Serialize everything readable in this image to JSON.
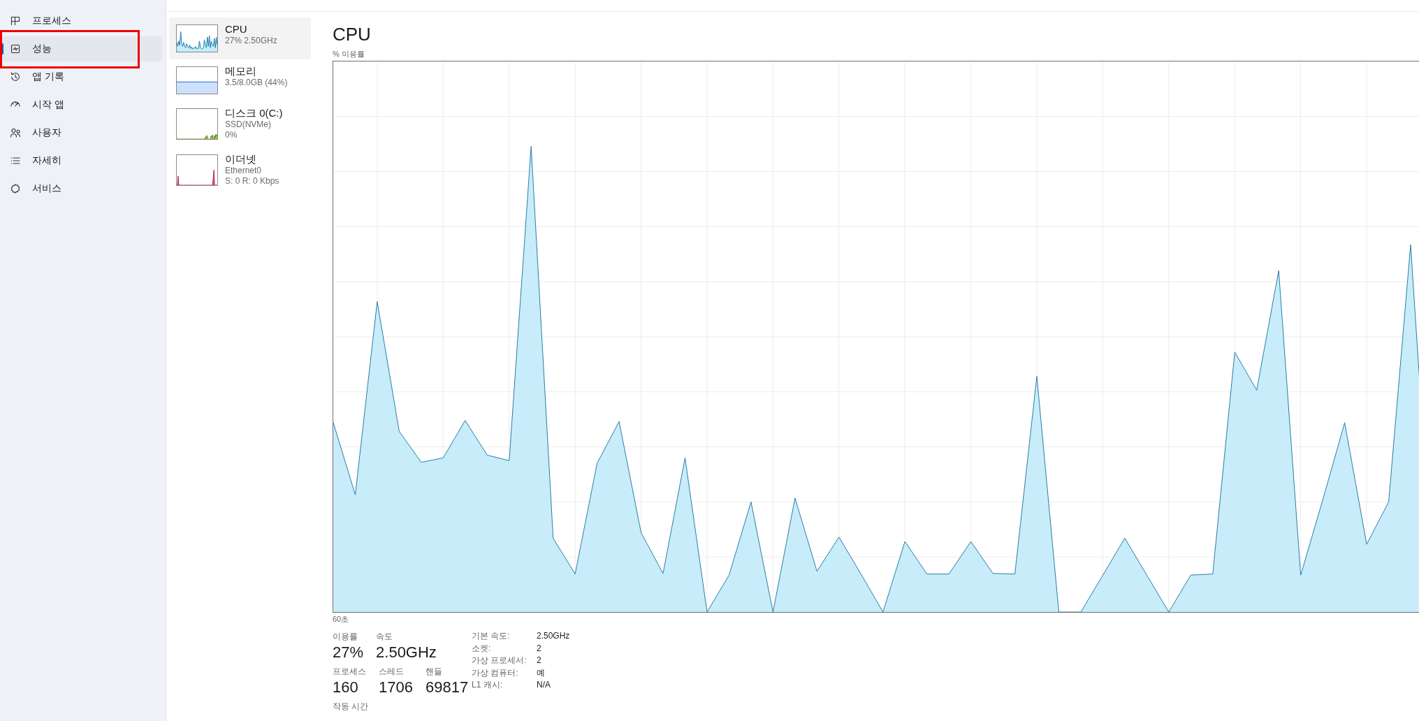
{
  "sidebar": {
    "items": [
      {
        "label": "프로세스",
        "selected": false,
        "annotated": false
      },
      {
        "label": "성능",
        "selected": true,
        "annotated": true
      },
      {
        "label": "앱 기록",
        "selected": false,
        "annotated": false
      },
      {
        "label": "시작 앱",
        "selected": false,
        "annotated": false
      },
      {
        "label": "사용자",
        "selected": false,
        "annotated": false
      },
      {
        "label": "자세히",
        "selected": false,
        "annotated": false
      },
      {
        "label": "서비스",
        "selected": false,
        "annotated": false
      }
    ]
  },
  "performance_list": {
    "items": [
      {
        "kind": "cpu",
        "name": "CPU",
        "details": [
          "27% 2.50GHz"
        ],
        "selected": true
      },
      {
        "kind": "memory",
        "name": "메모리",
        "details": [
          "3.5/8.0GB (44%)"
        ],
        "selected": false
      },
      {
        "kind": "disk",
        "name": "디스크 0(C:)",
        "details": [
          "SSD(NVMe)",
          "0%"
        ],
        "selected": false
      },
      {
        "kind": "network",
        "name": "이더넷",
        "details": [
          "Ethernet0",
          "S: 0 R: 0 Kbps"
        ],
        "selected": false
      }
    ]
  },
  "detail_panel": {
    "title": "CPU",
    "chart_label": "% 이용률",
    "time_label": "60초",
    "stats": [
      [
        {
          "label": "이용률",
          "value": "27%"
        },
        {
          "label": "속도",
          "value": "2.50GHz"
        }
      ],
      [
        {
          "label": "프로세스",
          "value": "160"
        },
        {
          "label": "스레드",
          "value": "1706"
        },
        {
          "label": "핸들",
          "value": "69817"
        }
      ],
      [
        {
          "label": "작동 시간"
        }
      ]
    ],
    "properties": [
      {
        "label": "기본 속도:",
        "value": "2.50GHz"
      },
      {
        "label": "소켓:",
        "value": "2"
      },
      {
        "label": "가상 프로세서:",
        "value": "2"
      },
      {
        "label": "가상 컴퓨터:",
        "value": "예"
      },
      {
        "label": "L1 캐시:",
        "value": "N/A"
      }
    ]
  }
}
